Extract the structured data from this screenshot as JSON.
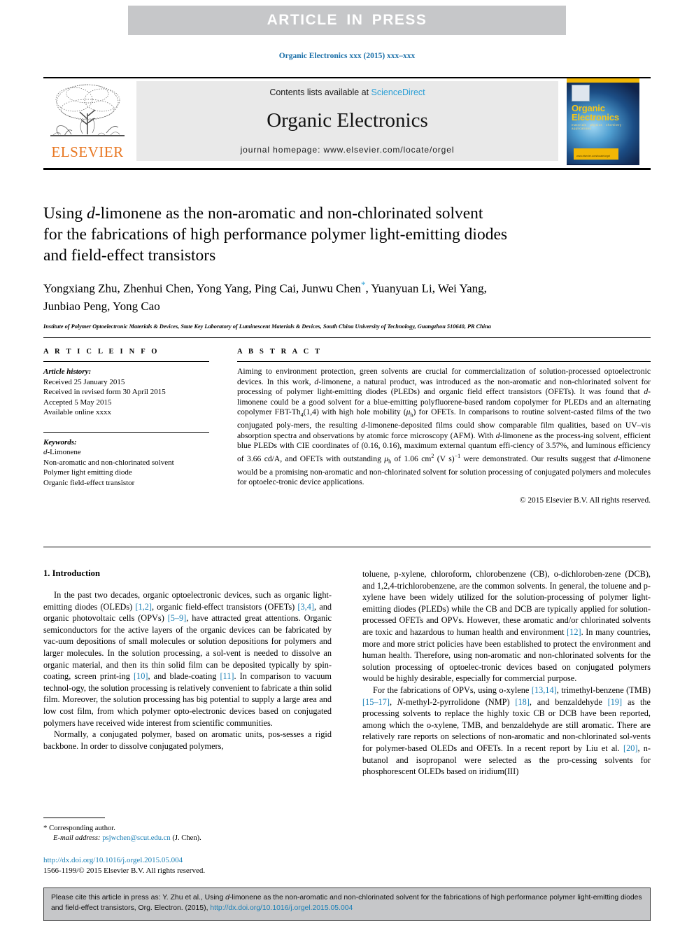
{
  "banner": {
    "text": "ARTICLE  IN  PRESS"
  },
  "running_head": "Organic Electronics xxx (2015) xxx–xxx",
  "masthead": {
    "contents_prefix": "Contents lists available at ",
    "sciencedirect": "ScienceDirect",
    "journal_name": "Organic Electronics",
    "homepage": "journal homepage: www.elsevier.com/locate/orgel",
    "publisher_wordmark": "ELSEVIER",
    "cover": {
      "title_line1": "Organic",
      "title_line2": "Electronics",
      "subtitle": "materials · physics · chemistry · applications",
      "box_caption": "www.elsevier.com/locate/orgel"
    }
  },
  "article": {
    "title_line1_pre": "Using ",
    "title_italic": "d",
    "title_line1_post": "-limonene as the non-aromatic and non-chlorinated solvent",
    "title_line2": "for the fabrications of high performance polymer light-emitting diodes",
    "title_line3": "and field-effect transistors",
    "authors_line1": "Yongxiang Zhu, Zhenhui Chen, Yong Yang, Ping Cai, Junwu Chen",
    "authors_star": "*",
    "authors_line1_post": ", Yuanyuan Li, Wei Yang,",
    "authors_line2": "Junbiao Peng, Yong Cao",
    "affiliation": "Institute of Polymer Optoelectronic Materials & Devices, State Key Laboratory of Luminescent Materials & Devices, South China University of Technology, Guangzhou 510640, PR China"
  },
  "article_info": {
    "heading": "A R T I C L E   I N F O",
    "history_label": "Article history:",
    "history": [
      "Received 25 January 2015",
      "Received in revised form 30 April 2015",
      "Accepted 5 May 2015",
      "Available online xxxx"
    ],
    "keywords_label": "Keywords:",
    "keywords": [
      "d-Limonene",
      "Non-aromatic and non-chlorinated solvent",
      "Polymer light emitting diode",
      "Organic field-effect transistor"
    ]
  },
  "abstract": {
    "heading": "A B S T R A C T",
    "p1": "Aiming to environment protection, green solvents are crucial for commercialization of solution-processed optoelectronic devices. In this work, d-limonene, a natural product, was introduced as the non-aromatic and non-chlorinated solvent for processing of polymer light-emitting diodes (PLEDs) and organic field effect transistors (OFETs). It was found that d-limonene could be a good solvent for a blue-emitting polyfluorene-based random copolymer for PLEDs and an alternating copolymer FBT-Th4(1,4) with high hole mobility (μh) for OFETs. In comparisons to routine solvent-casted films of the two conjugated polymers, the resulting d-limonene-deposited films could show comparable film qualities, based on UV–vis absorption spectra and observations by atomic force microscopy (AFM). With d-limonene as the processing solvent, efficient blue PLEDs with CIE coordinates of (0.16, 0.16), maximum external quantum efficiency of 3.57%, and luminous efficiency of 3.66 cd/A, and OFETs with outstanding μh of 1.06 cm2 (V s)−1 were demonstrated. Our results suggest that d-limonene would be a promising non-aromatic and non-chlorinated solvent for solution processing of conjugated polymers and molecules for optoelectronic device applications.",
    "copyright": "© 2015 Elsevier B.V. All rights reserved."
  },
  "intro": {
    "section_title": "1. Introduction",
    "left_p1": "In the past two decades, organic optoelectronic devices, such as organic light-emitting diodes (OLEDs) [1,2], organic field-effect transistors (OFETs) [3,4], and organic photovoltaic cells (OPVs) [5–9], have attracted great attentions. Organic semiconductors for the active layers of the organic devices can be fabricated by vacuum depositions of small molecules or solution depositions for polymers and larger molecules. In the solution processing, a solvent is needed to dissolve an organic material, and then its thin solid film can be deposited typically by spin-coating, screen printing [10], and blade-coating [11]. In comparison to vacuum technology, the solution processing is relatively convenient to fabricate a thin solid film. Moreover, the solution processing has big potential to supply a large area and low cost film, from which polymer optoelectronic devices based on conjugated polymers have received wide interest from scientific communities.",
    "left_p2": "Normally, a conjugated polymer, based on aromatic units, possesses a rigid backbone. In order to dissolve conjugated polymers,",
    "right_p1": "toluene, p-xylene, chloroform, chlorobenzene (CB), o-dichlorobenzene (DCB), and 1,2,4-trichlorobenzene, are the common solvents. In general, the toluene and p-xylene have been widely utilized for the solution-processing of polymer light-emitting diodes (PLEDs) while the CB and DCB are typically applied for solution-processed OFETs and OPVs. However, these aromatic and/or chlorinated solvents are toxic and hazardous to human health and environment [12]. In many countries, more and more strict policies have been established to protect the environment and human health. Therefore, using non-aromatic and non-chlorinated solvents for the solution processing of optoelectronic devices based on conjugated polymers would be highly desirable, especially for commercial purpose.",
    "right_p2": "For the fabrications of OPVs, using o-xylene [13,14], trimethylbenzene (TMB) [15–17], N-methyl-2-pyrrolidone (NMP) [18], and benzaldehyde [19] as the processing solvents to replace the highly toxic CB or DCB have been reported, among which the o-xylene, TMB, and benzaldehyde are still aromatic. There are relatively rare reports on selections of non-aromatic and non-chlorinated solvents for polymer-based OLEDs and OFETs. In a recent report by Liu et al. [20], n-butanol and isopropanol were selected as the processing solvents for phosphorescent OLEDs based on iridium(III)"
  },
  "footnote": {
    "star": "*",
    "corresponding": "Corresponding author.",
    "email_label": "E-mail address:",
    "email": "psjwchen@scut.edu.cn",
    "email_owner": "(J. Chen).",
    "doi": "http://dx.doi.org/10.1016/j.orgel.2015.05.004",
    "issn": "1566-1199/© 2015 Elsevier B.V. All rights reserved."
  },
  "cite_box": {
    "line1": "Please cite this article in press as: Y. Zhu et al., Using d-limonene as the non-aromatic and non-chlorinated solvent for the fabrications of high performance",
    "line2_pre": "polymer light-emitting diodes and field-effect transistors, Org. Electron. (2015), ",
    "line2_link": "http://dx.doi.org/10.1016/j.orgel.2015.05.004"
  },
  "colors": {
    "accent_blue": "#1a7fb5",
    "link_blue": "#2a9fd6",
    "elsevier_orange": "#e87722",
    "banner_gray": "#c6c7c9",
    "masthead_gray": "#e9e9e9",
    "cover_yellow": "#f2b705"
  }
}
